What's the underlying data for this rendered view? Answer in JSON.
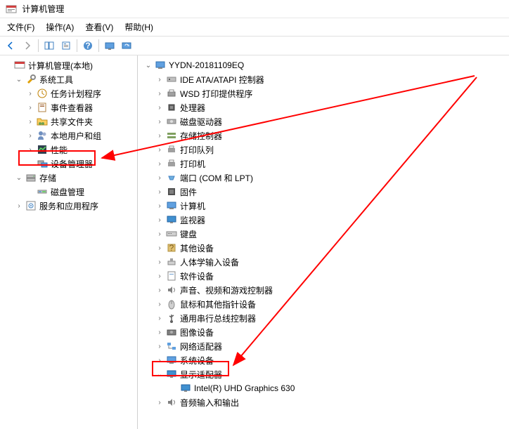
{
  "window": {
    "title": "计算机管理"
  },
  "menu": {
    "file": "文件(F)",
    "action": "操作(A)",
    "view": "查看(V)",
    "help": "帮助(H)"
  },
  "leftTree": {
    "root": "计算机管理(本地)",
    "systemTools": "系统工具",
    "taskScheduler": "任务计划程序",
    "eventViewer": "事件查看器",
    "sharedFolders": "共享文件夹",
    "localUsers": "本地用户和组",
    "performance": "性能",
    "deviceManager": "设备管理器",
    "storage": "存储",
    "diskManagement": "磁盘管理",
    "services": "服务和应用程序"
  },
  "rightTree": {
    "computer": "YYDN-20181109EQ",
    "ideAtapi": "IDE ATA/ATAPI 控制器",
    "wsd": "WSD 打印提供程序",
    "processor": "处理器",
    "diskDrives": "磁盘驱动器",
    "storageControllers": "存储控制器",
    "printQueue": "打印队列",
    "printer": "打印机",
    "ports": "端口 (COM 和 LPT)",
    "firmware": "固件",
    "computerType": "计算机",
    "monitor": "监视器",
    "keyboard": "键盘",
    "otherDevices": "其他设备",
    "hid": "人体学输入设备",
    "softwareDevices": "软件设备",
    "sound": "声音、视频和游戏控制器",
    "mouse": "鼠标和其他指针设备",
    "usb": "通用串行总线控制器",
    "imaging": "图像设备",
    "network": "网络适配器",
    "systemDevices": "系统设备",
    "displayAdapters": "显示适配器",
    "displayCard": "Intel(R) UHD Graphics 630",
    "audio": "音频输入和输出"
  },
  "colors": {
    "highlight": "#ff0000"
  }
}
